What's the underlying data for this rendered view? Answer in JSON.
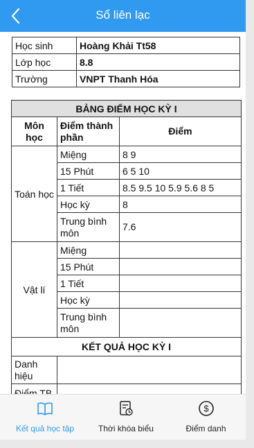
{
  "header": {
    "title": "Sổ liên lạc",
    "back_icon": "chevron-left-icon"
  },
  "student_info": [
    {
      "label": "Học sinh",
      "value": "Hoàng Khải Tt58"
    },
    {
      "label": "Lớp học",
      "value": "8.8"
    },
    {
      "label": "Trường",
      "value": "VNPT Thanh Hóa"
    }
  ],
  "grades": {
    "section_title": "BẢNG ĐIỂM HỌC KỲ I",
    "col_subject": "Môn học",
    "col_component": "Điểm thành phần",
    "col_score": "Điểm",
    "subjects": [
      {
        "name": "Toán học",
        "rows": [
          {
            "component": "Miệng",
            "scores": "8  9"
          },
          {
            "component": "15 Phút",
            "scores": "6  5  10"
          },
          {
            "component": "1 Tiết",
            "scores": "8.5  9.5  10  5.9  5.6  8  5"
          },
          {
            "component": "Học kỳ",
            "scores": "8"
          },
          {
            "component": "Trung bình môn",
            "scores": "7.6"
          }
        ]
      },
      {
        "name": "Vật lí",
        "rows": [
          {
            "component": "Miệng",
            "scores": ""
          },
          {
            "component": "15 Phút",
            "scores": ""
          },
          {
            "component": "1 Tiết",
            "scores": ""
          },
          {
            "component": "Học kỳ",
            "scores": ""
          },
          {
            "component": "Trung bình môn",
            "scores": ""
          }
        ]
      }
    ]
  },
  "results": {
    "section_title": "KẾT QUẢ HỌC KỲ I",
    "rows": [
      {
        "label": "Danh hiệu",
        "value": ""
      },
      {
        "label": "Điểm TB",
        "value": ""
      }
    ]
  },
  "bottom_nav": {
    "items": [
      {
        "label": "Kết quả học tập",
        "icon": "open-book-icon",
        "active": true
      },
      {
        "label": "Thời khóa biểu",
        "icon": "schedule-icon",
        "active": false
      },
      {
        "label": "Điểm danh",
        "icon": "dollar-circle-icon",
        "active": false
      }
    ]
  },
  "colors": {
    "accent": "#2f9af0",
    "header_row": "#e0e0e0"
  }
}
